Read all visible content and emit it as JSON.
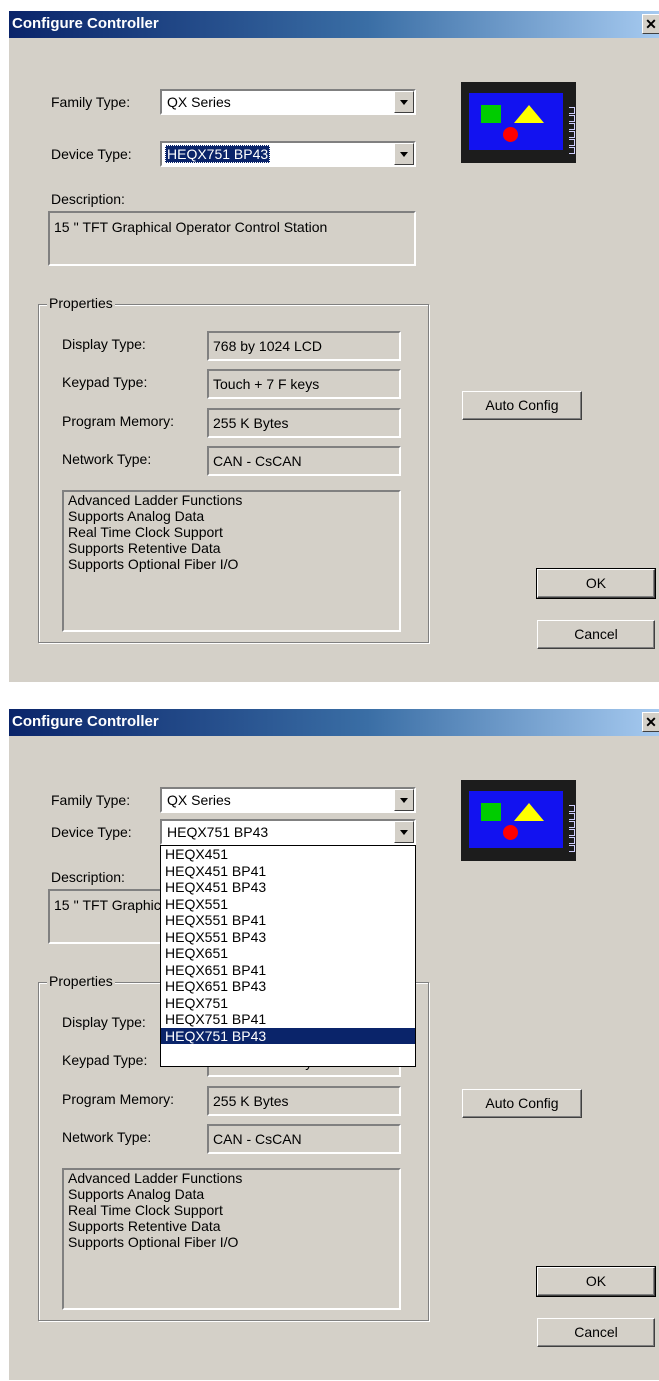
{
  "dialog_title": "Configure Controller",
  "close_glyph": "✕",
  "labels": {
    "family_type": "Family Type:",
    "device_type": "Device Type:",
    "description": "Description:",
    "properties": "Properties",
    "display_type": "Display Type:",
    "keypad_type": "Keypad Type:",
    "program_memory": "Program Memory:",
    "network_type": "Network Type:"
  },
  "values": {
    "family_type": "QX Series",
    "device_type": "HEQX751 BP43",
    "description": "15 '' TFT Graphical Operator Control Station",
    "display_type": "768 by 1024 LCD",
    "keypad_type": "Touch + 7 F keys",
    "program_memory": "255 K Bytes",
    "network_type": "CAN - CsCAN"
  },
  "features": [
    "Advanced Ladder Functions",
    "Supports Analog Data",
    "Real Time Clock Support",
    "Supports Retentive Data",
    "Supports Optional Fiber I/O"
  ],
  "buttons": {
    "auto_config": "Auto Config",
    "ok": "OK",
    "cancel": "Cancel"
  },
  "device_options": [
    "HEQX451",
    "HEQX451 BP41",
    "HEQX451 BP43",
    "HEQX551",
    "HEQX551 BP41",
    "HEQX551 BP43",
    "HEQX651",
    "HEQX651 BP41",
    "HEQX651 BP43",
    "HEQX751",
    "HEQX751 BP41",
    "HEQX751 BP43"
  ],
  "icons": {
    "close": "close-icon",
    "dropdown_arrow": "chevron-down-icon",
    "device_picture": "controller-device-icon"
  },
  "colors": {
    "titlebar": "#0a246a",
    "selection": "#0a246a",
    "dialog_bg": "#d4d0c8"
  }
}
